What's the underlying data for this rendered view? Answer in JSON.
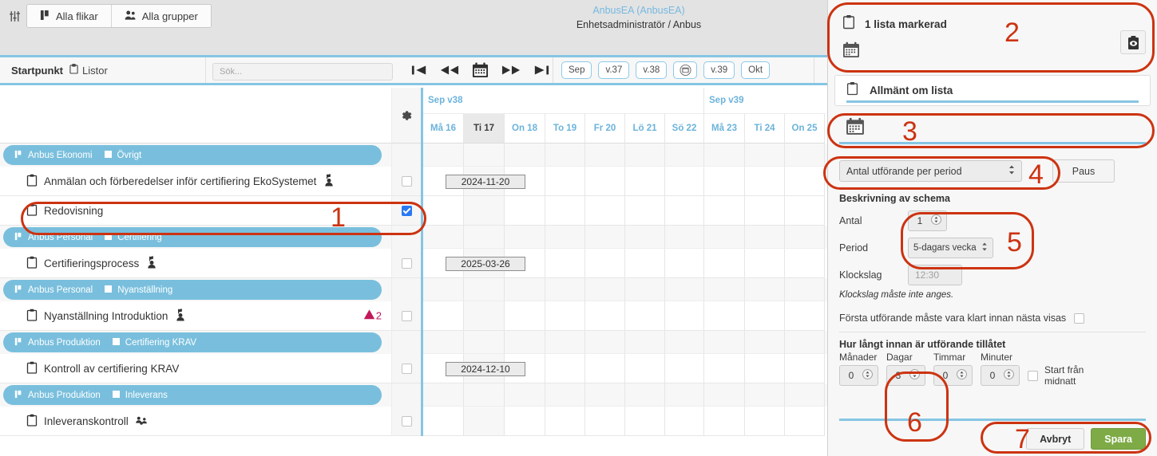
{
  "topbar": {
    "filter_icon": "sliders-icon",
    "tabs": [
      {
        "label": "Alla flikar",
        "icon": "flag-icon"
      },
      {
        "label": "Alla grupper",
        "icon": "group-icon"
      }
    ],
    "user_name": "AnbusEA (AnbusEA)",
    "user_role": "Enhetsadministratör / Anbus"
  },
  "secondbar": {
    "startpunkt_label": "Startpunkt",
    "listor_label": "Listor",
    "search_placeholder": "Sök...",
    "search_value": "",
    "nav_icons": [
      "skip-back-icon",
      "rewind-icon",
      "calendar-icon",
      "fast-forward-icon",
      "skip-forward-icon"
    ],
    "week_pills": [
      {
        "label": "Sep",
        "type": "text"
      },
      {
        "label": "v.37",
        "type": "text"
      },
      {
        "label": "v.38",
        "type": "text"
      },
      {
        "label": "",
        "type": "icon"
      },
      {
        "label": "v.39",
        "type": "text"
      },
      {
        "label": "Okt",
        "type": "text"
      }
    ]
  },
  "grid": {
    "gear_icon": "gear-icon",
    "weeks": [
      {
        "label": "Sep v38",
        "days": 7
      },
      {
        "label": "Sep v39",
        "days": 3
      }
    ],
    "days": [
      {
        "label": "Må 16",
        "today": false
      },
      {
        "label": "Ti 17",
        "today": true
      },
      {
        "label": "On 18",
        "today": false
      },
      {
        "label": "To 19",
        "today": false
      },
      {
        "label": "Fr 20",
        "today": false
      },
      {
        "label": "Lö 21",
        "today": false
      },
      {
        "label": "Sö 22",
        "today": false
      },
      {
        "label": "Må 23",
        "today": false
      },
      {
        "label": "Ti 24",
        "today": false
      },
      {
        "label": "On 25",
        "today": false
      }
    ],
    "rows": [
      {
        "type": "group",
        "org": "Anbus Ekonomi",
        "category": "Övrigt"
      },
      {
        "type": "item",
        "name": "Anmälan och förberedelser inför certifiering EkoSystemet",
        "trailing_icon": "person-flag-icon",
        "checked": false,
        "date_chip": "2024-11-20",
        "chip_col": 1
      },
      {
        "type": "item",
        "name": "Redovisning",
        "trailing_icon": "",
        "checked": true,
        "date_chip": "",
        "chip_col": -1
      },
      {
        "type": "group",
        "org": "Anbus Personal",
        "category": "Certifiering"
      },
      {
        "type": "item",
        "name": "Certifieringsprocess",
        "trailing_icon": "person-flag-icon",
        "checked": false,
        "date_chip": "2025-03-26",
        "chip_col": 1
      },
      {
        "type": "group",
        "org": "Anbus Personal",
        "category": "Nyanställning"
      },
      {
        "type": "item",
        "name": "Nyanställning Introduktion",
        "trailing_icon": "person-flag-icon",
        "checked": false,
        "date_chip": "",
        "chip_col": -1,
        "warn_count": "2",
        "warn_icon": "warning-triangle-icon"
      },
      {
        "type": "group",
        "org": "Anbus Produktion",
        "category": "Certifiering KRAV"
      },
      {
        "type": "item",
        "name": "Kontroll av certifiering KRAV",
        "trailing_icon": "",
        "checked": false,
        "date_chip": "2024-12-10",
        "chip_col": 1
      },
      {
        "type": "group",
        "org": "Anbus Produktion",
        "category": "Inleverans"
      },
      {
        "type": "item",
        "name": "Inleveranskontroll",
        "trailing_icon": "shared-users-icon",
        "checked": false,
        "date_chip": "",
        "chip_col": -1
      }
    ]
  },
  "panel": {
    "header_title": "1 lista markerad",
    "header_clipboard_icon": "clipboard-icon",
    "header_calendar_icon": "calendar-icon",
    "eye_button_icon": "clipboard-eye-icon",
    "tab_general_label": "Allmänt om lista",
    "tab_general_icon": "clipboard-icon",
    "tab_calendar_icon": "calendar-icon",
    "schedule_type_value": "Antal utförande per period",
    "paus_label": "Paus",
    "section_title": "Beskrivning av schema",
    "antal_label": "Antal",
    "antal_value": "1",
    "period_label": "Period",
    "period_value": "5-dagars vecka",
    "klockslag_label": "Klockslag",
    "klockslag_placeholder": "12:30",
    "klockslag_hint": "Klockslag måste inte anges.",
    "first_done_label": "Första utförande måste vara klart innan nästa visas",
    "first_done_checked": false,
    "lead_section_title": "Hur långt innan är utförande tillåtet",
    "lead_fields": [
      {
        "label": "Månader",
        "value": "0"
      },
      {
        "label": "Dagar",
        "value": "3"
      },
      {
        "label": "Timmar",
        "value": "0"
      },
      {
        "label": "Minuter",
        "value": "0"
      }
    ],
    "midnight_label_line1": "Start från",
    "midnight_label_line2": "midnatt",
    "midnight_checked": false,
    "cancel_label": "Avbryt",
    "save_label": "Spara"
  },
  "annotations": [
    {
      "number": "1"
    },
    {
      "number": "2"
    },
    {
      "number": "3"
    },
    {
      "number": "4"
    },
    {
      "number": "5"
    },
    {
      "number": "6"
    },
    {
      "number": "7"
    }
  ],
  "colors": {
    "accent_blue": "#86c5e3",
    "group_blue": "#79bfdd",
    "checkbox_blue": "#2979f5",
    "save_green": "#7eab46",
    "annotation_red": "#cc3311",
    "warn_pink": "#c2185b"
  }
}
